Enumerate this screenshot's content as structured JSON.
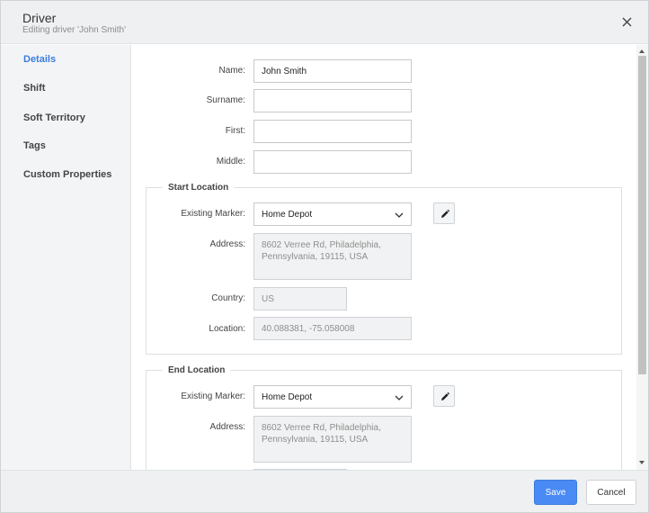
{
  "header": {
    "title": "Driver",
    "subtitle": "Editing driver 'John Smith'"
  },
  "sidebar": {
    "items": [
      {
        "label": "Details",
        "active": true
      },
      {
        "label": "Shift"
      },
      {
        "label": "Soft Territory"
      },
      {
        "label": "Tags"
      },
      {
        "label": "Custom Properties"
      }
    ]
  },
  "form": {
    "name": {
      "label": "Name:",
      "value": "John Smith"
    },
    "surname": {
      "label": "Surname:",
      "value": ""
    },
    "first": {
      "label": "First:",
      "value": ""
    },
    "middle": {
      "label": "Middle:",
      "value": ""
    }
  },
  "start_location": {
    "legend": "Start Location",
    "marker_label": "Existing Marker:",
    "marker_value": "Home Depot",
    "address_label": "Address:",
    "address_line1": "8602 Verree Rd, Philadelphia,",
    "address_line2": "Pennsylvania, 19115, USA",
    "country_label": "Country:",
    "country_value": "US",
    "location_label": "Location:",
    "location_value": "40.088381, -75.058008"
  },
  "end_location": {
    "legend": "End Location",
    "marker_label": "Existing Marker:",
    "marker_value": "Home Depot",
    "address_label": "Address:",
    "address_line1": "8602 Verree Rd, Philadelphia,",
    "address_line2": "Pennsylvania, 19115, USA"
  },
  "footer": {
    "save_label": "Save",
    "cancel_label": "Cancel"
  },
  "colors": {
    "accent": "#4a8af4",
    "active_nav": "#3b7ddd"
  },
  "icons": {
    "close": "close-icon",
    "edit": "pencil-icon",
    "dropdown": "chevron-down-icon"
  }
}
